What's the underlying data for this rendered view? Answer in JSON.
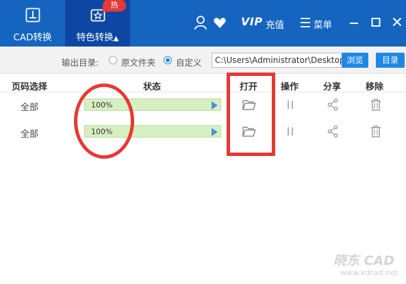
{
  "header": {
    "tabs": [
      {
        "label": "CAD转换",
        "icon": "cad-convert-icon"
      },
      {
        "label": "特色转换",
        "icon": "special-convert-icon",
        "badge": "热",
        "active": true
      }
    ],
    "vip": "VIP",
    "vip_label": "充值",
    "menu_label": "菜单"
  },
  "output": {
    "label": "输出目录:",
    "options": [
      "原文件夹",
      "自定义"
    ],
    "selected": "自定义",
    "path": "C:\\Users\\Administrator\\Desktop",
    "browse_button": "浏览",
    "dir_button": "目录"
  },
  "table": {
    "columns": [
      "页码选择",
      "状态",
      "打开",
      "操作",
      "分享",
      "移除"
    ],
    "rows": [
      {
        "page": "全部",
        "progress": "100%"
      },
      {
        "page": "全部",
        "progress": "100%"
      }
    ]
  },
  "watermark": {
    "logo": "晓东 CAD",
    "url": "www.xdcad.net"
  },
  "colors": {
    "header_bg": "#1565c0",
    "active_tab_bg": "#0d47a1",
    "accent": "#1e88e5",
    "badge": "#e53935",
    "progress_bg": "#dff2cf",
    "annotation": "#e53935"
  }
}
